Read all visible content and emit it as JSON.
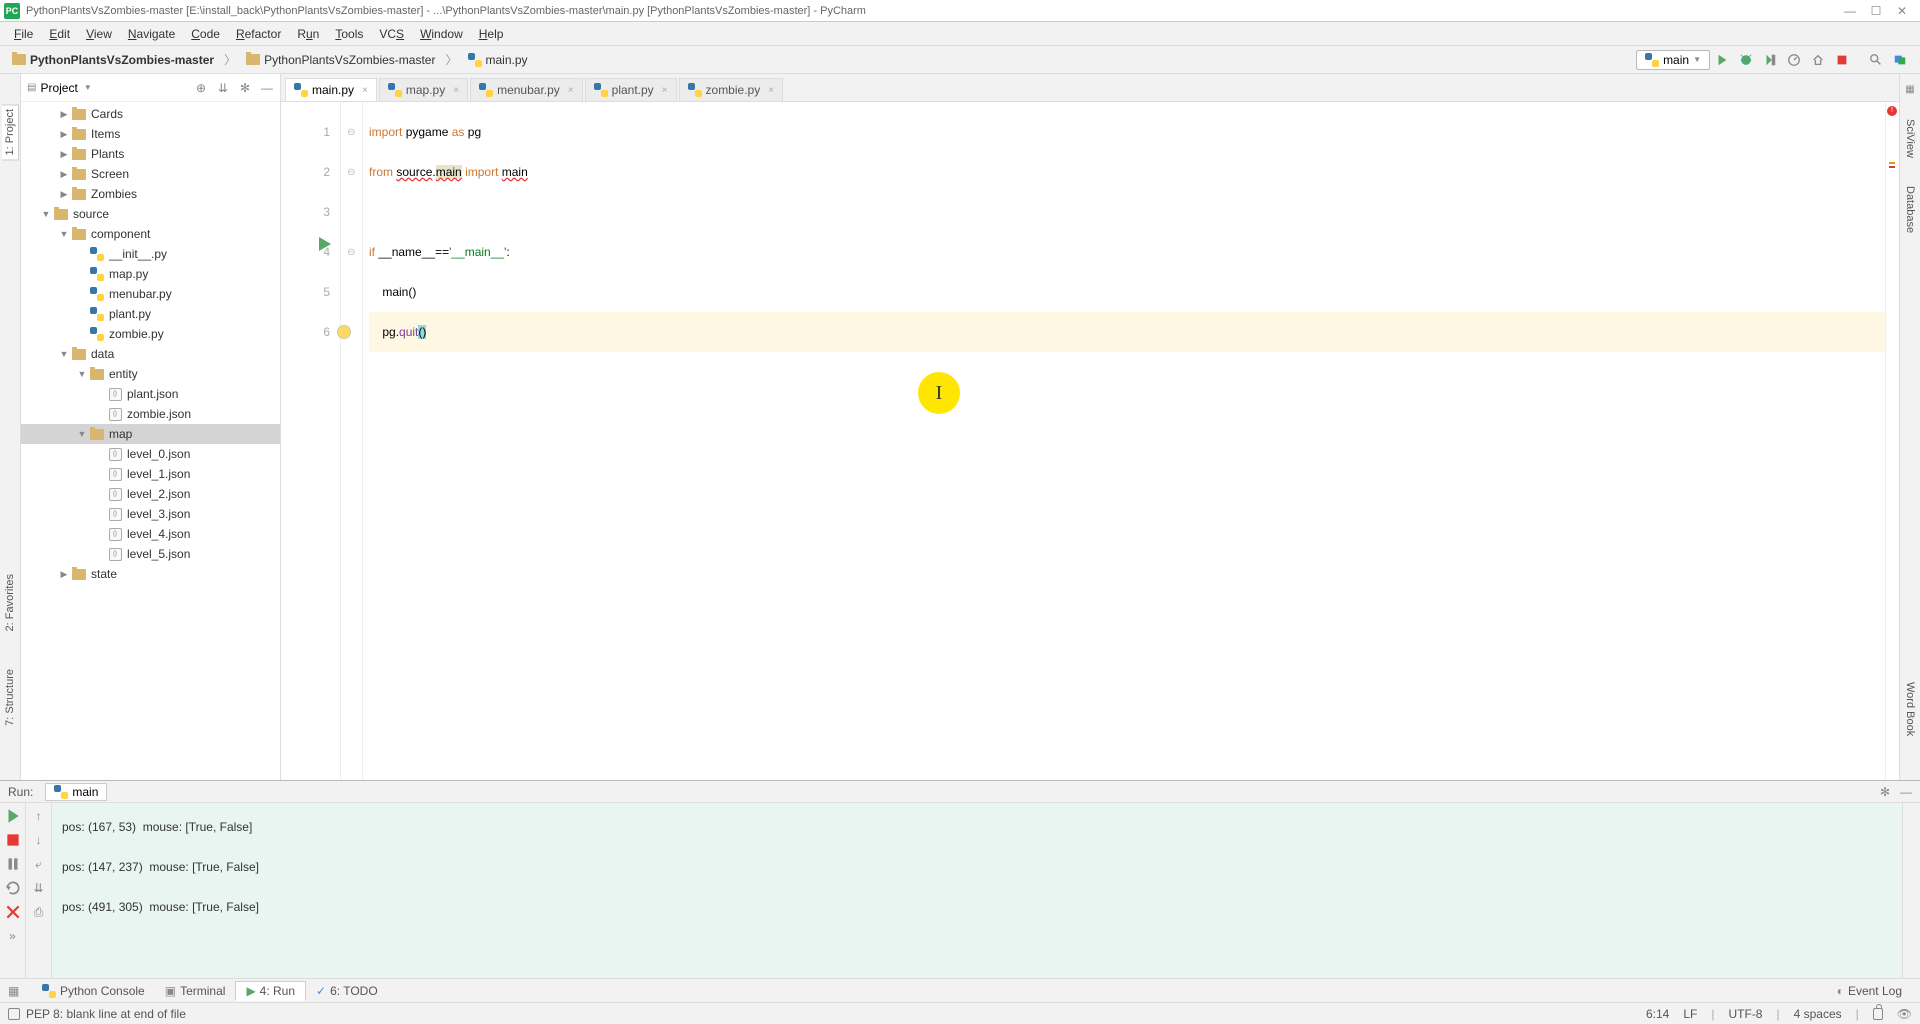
{
  "titlebar": {
    "text": "PythonPlantsVsZombies-master [E:\\install_back\\PythonPlantsVsZombies-master] - ...\\PythonPlantsVsZombies-master\\main.py [PythonPlantsVsZombies-master] - PyCharm"
  },
  "menu": [
    "File",
    "Edit",
    "View",
    "Navigate",
    "Code",
    "Refactor",
    "Run",
    "Tools",
    "VCS",
    "Window",
    "Help"
  ],
  "breadcrumb": {
    "root": "PythonPlantsVsZombies-master",
    "folder": "PythonPlantsVsZombies-master",
    "file": "main.py"
  },
  "run_config": {
    "name": "main"
  },
  "left_tabs": {
    "project": "1: Project",
    "favorites": "2: Favorites",
    "structure": "7: Structure"
  },
  "right_tabs": {
    "sciview": "SciView",
    "database": "Database",
    "wordbook": "Word Book"
  },
  "project": {
    "title": "Project",
    "tree": [
      {
        "depth": 2,
        "arrow": "closed",
        "icon": "folder",
        "label": "Cards"
      },
      {
        "depth": 2,
        "arrow": "closed",
        "icon": "folder",
        "label": "Items"
      },
      {
        "depth": 2,
        "arrow": "closed",
        "icon": "folder",
        "label": "Plants"
      },
      {
        "depth": 2,
        "arrow": "closed",
        "icon": "folder",
        "label": "Screen"
      },
      {
        "depth": 2,
        "arrow": "closed",
        "icon": "folder",
        "label": "Zombies"
      },
      {
        "depth": 1,
        "arrow": "open",
        "icon": "folder",
        "label": "source"
      },
      {
        "depth": 2,
        "arrow": "open",
        "icon": "folder",
        "label": "component"
      },
      {
        "depth": 3,
        "arrow": "none",
        "icon": "py",
        "label": "__init__.py"
      },
      {
        "depth": 3,
        "arrow": "none",
        "icon": "py",
        "label": "map.py"
      },
      {
        "depth": 3,
        "arrow": "none",
        "icon": "py",
        "label": "menubar.py"
      },
      {
        "depth": 3,
        "arrow": "none",
        "icon": "py",
        "label": "plant.py"
      },
      {
        "depth": 3,
        "arrow": "none",
        "icon": "py",
        "label": "zombie.py"
      },
      {
        "depth": 2,
        "arrow": "open",
        "icon": "folder",
        "label": "data"
      },
      {
        "depth": 3,
        "arrow": "open",
        "icon": "folder",
        "label": "entity"
      },
      {
        "depth": 4,
        "arrow": "none",
        "icon": "json",
        "label": "plant.json"
      },
      {
        "depth": 4,
        "arrow": "none",
        "icon": "json",
        "label": "zombie.json"
      },
      {
        "depth": 3,
        "arrow": "open",
        "icon": "folder",
        "label": "map",
        "sel": true
      },
      {
        "depth": 4,
        "arrow": "none",
        "icon": "json",
        "label": "level_0.json"
      },
      {
        "depth": 4,
        "arrow": "none",
        "icon": "json",
        "label": "level_1.json"
      },
      {
        "depth": 4,
        "arrow": "none",
        "icon": "json",
        "label": "level_2.json"
      },
      {
        "depth": 4,
        "arrow": "none",
        "icon": "json",
        "label": "level_3.json"
      },
      {
        "depth": 4,
        "arrow": "none",
        "icon": "json",
        "label": "level_4.json"
      },
      {
        "depth": 4,
        "arrow": "none",
        "icon": "json",
        "label": "level_5.json"
      },
      {
        "depth": 2,
        "arrow": "closed",
        "icon": "folder",
        "label": "state"
      }
    ]
  },
  "tabs": [
    {
      "name": "main.py",
      "active": true
    },
    {
      "name": "map.py",
      "active": false
    },
    {
      "name": "menubar.py",
      "active": false
    },
    {
      "name": "plant.py",
      "active": false
    },
    {
      "name": "zombie.py",
      "active": false
    }
  ],
  "code": {
    "lines": [
      "1",
      "2",
      "3",
      "4",
      "5",
      "6"
    ],
    "l1_kw1": "import",
    "l1_mod": "pygame",
    "l1_kw2": "as",
    "l1_alias": "pg",
    "l2_kw1": "from",
    "l2_pkg": "source",
    "l2_dot": ".",
    "l2_main": "main",
    "l2_kw2": "import",
    "l2_main2": "main",
    "l4_kw": "if",
    "l4_name": "__name__",
    "l4_eq": "==",
    "l4_q1": "'",
    "l4_str": "__main__",
    "l4_q2": "'",
    "l4_colon": ":",
    "l5_indent": "    ",
    "l5_fn": "main",
    "l5_p": "()",
    "l6_indent": "    ",
    "l6_obj": "pg",
    "l6_dot": ".",
    "l6_fn": "quit",
    "l6_p": "()"
  },
  "run_panel": {
    "label": "Run:",
    "tab": "main",
    "lines": [
      "pos: (167, 53)  mouse: [True, False]",
      "pos: (147, 237)  mouse: [True, False]",
      "pos: (491, 305)  mouse: [True, False]"
    ]
  },
  "bottom_tools": {
    "python_console": "Python Console",
    "terminal": "Terminal",
    "run": "4: Run",
    "todo": "6: TODO",
    "event_log": "Event Log"
  },
  "status": {
    "msg": "PEP 8: blank line at end of file",
    "pos": "6:14",
    "lf": "LF",
    "enc": "UTF-8",
    "indent": "4 spaces"
  }
}
